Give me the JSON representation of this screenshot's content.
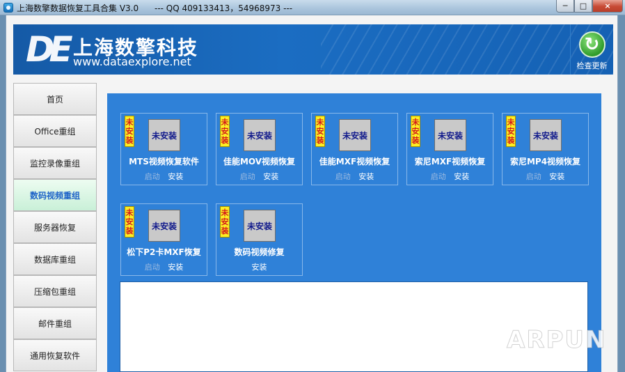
{
  "window": {
    "title": "上海数擎数据恢复工具合集 V3.0      --- QQ 409133413，54968973 ---",
    "controls": [
      "─",
      "□",
      "×"
    ]
  },
  "banner": {
    "logo_mark": "DE",
    "company": "上海数擎科技",
    "url": "www.dataexplore.net",
    "update_label": "检查更新"
  },
  "sidebar": {
    "items": [
      {
        "label": "首页"
      },
      {
        "label": "Office重组"
      },
      {
        "label": "监控录像重组"
      },
      {
        "label": "数码视频重组"
      },
      {
        "label": "服务器恢复"
      },
      {
        "label": "数据库重组"
      },
      {
        "label": "压缩包重组"
      },
      {
        "label": "邮件重组"
      },
      {
        "label": "通用恢复软件"
      }
    ],
    "active_index": 3
  },
  "tools": [
    {
      "name": "MTS视频恢复软件",
      "badge": [
        "未",
        "安",
        "装"
      ],
      "icon_text": "未安装",
      "launch": "启动",
      "install": "安装"
    },
    {
      "name": "佳能MOV视频恢复",
      "badge": [
        "未",
        "安",
        "装"
      ],
      "icon_text": "未安装",
      "launch": "启动",
      "install": "安装"
    },
    {
      "name": "佳能MXF视频恢复",
      "badge": [
        "未",
        "安",
        "装"
      ],
      "icon_text": "未安装",
      "launch": "启动",
      "install": "安装"
    },
    {
      "name": "索尼MXF视频恢复",
      "badge": [
        "未",
        "安",
        "装"
      ],
      "icon_text": "未安装",
      "launch": "启动",
      "install": "安装"
    },
    {
      "name": "索尼MP4视频恢复",
      "badge": [
        "未",
        "安",
        "装"
      ],
      "icon_text": "未安装",
      "launch": "启动",
      "install": "安装"
    },
    {
      "name": "松下P2卡MXF恢复",
      "badge": [
        "未",
        "安",
        "装"
      ],
      "icon_text": "未安装",
      "launch": "启动",
      "install": "安装"
    },
    {
      "name": "数码视频修复",
      "badge": [
        "未",
        "安",
        "装"
      ],
      "icon_text": "未安装",
      "launch": "",
      "install": "安装"
    }
  ],
  "watermark": "ARPUN",
  "colors": {
    "panel_blue": "#2f81d8",
    "badge_yellow": "#fcef23",
    "badge_text_red": "#d31b1b",
    "active_tab_text": "#1e63c8"
  }
}
